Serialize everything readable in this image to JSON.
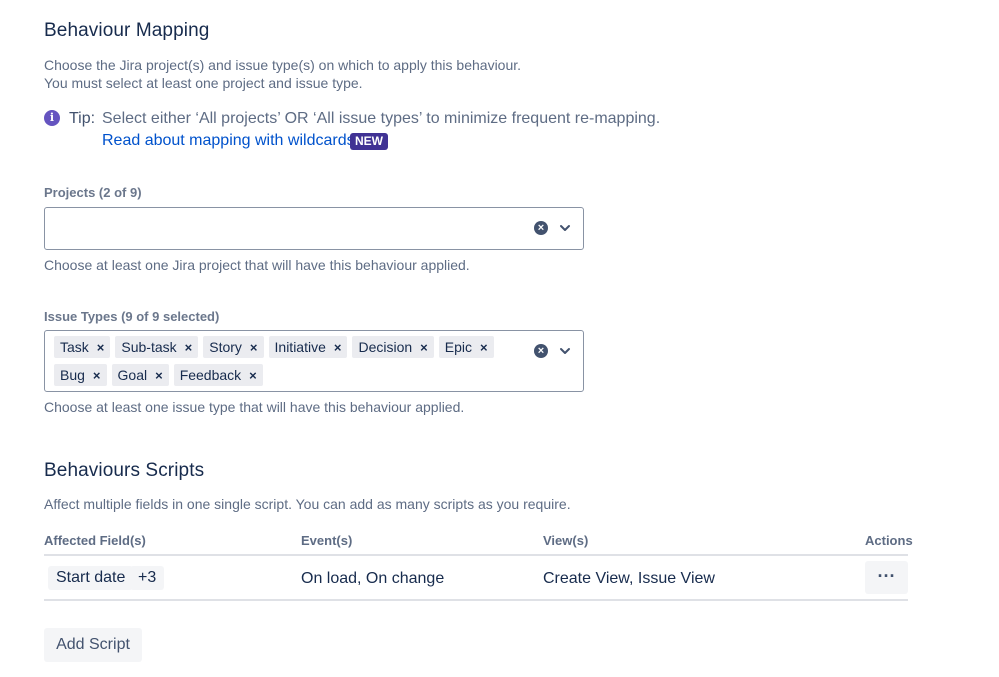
{
  "mapping": {
    "title": "Behaviour Mapping",
    "description_line1": "Choose the Jira project(s) and issue type(s) on which to apply this behaviour.",
    "description_line2": "You must select at least one project and issue type.",
    "tip_label": "Tip:",
    "tip_text": "Select either ‘All projects’ OR ‘All issue types’ to minimize frequent re-mapping.",
    "tip_link": "Read about mapping with wildcards",
    "tip_badge": "NEW",
    "info_icon": "info-icon",
    "accent": "#6554c0",
    "badge_color": "#403294",
    "link_color": "#0052cc"
  },
  "projects": {
    "label": "Projects (2 of 9)",
    "helper": "Choose at least one Jira project that will have this behaviour applied.",
    "clear_icon": "clear-icon",
    "dropdown_icon": "chevron-down-icon"
  },
  "issue_types": {
    "label": "Issue Types (9 of 9 selected)",
    "helper": "Choose at least one issue type that will have this behaviour applied.",
    "tags": [
      "Task",
      "Sub-task",
      "Story",
      "Initiative",
      "Decision",
      "Epic",
      "Bug",
      "Goal",
      "Feedback"
    ],
    "remove_glyph": "×",
    "clear_icon": "clear-icon",
    "dropdown_icon": "chevron-down-icon"
  },
  "scripts": {
    "title": "Behaviours Scripts",
    "description": "Affect multiple fields in one single script. You can add as many scripts as you require.",
    "columns": {
      "fields": "Affected Field(s)",
      "events": "Event(s)",
      "views": "View(s)",
      "actions": "Actions"
    },
    "rows": [
      {
        "field": "Start date",
        "more": "+3",
        "events": "On load, On change",
        "views": "Create View, Issue View",
        "actions_glyph": "···"
      }
    ],
    "add_button": "Add Script"
  }
}
